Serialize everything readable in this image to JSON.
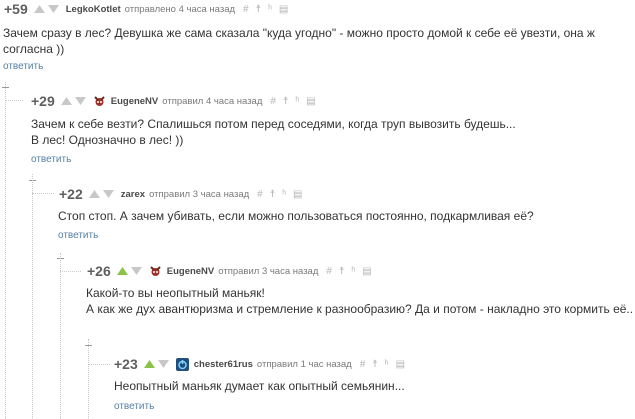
{
  "comments": [
    {
      "rating": "+59",
      "user": "LegkoKotlet",
      "meta": "отправлено 4 часа назад",
      "text": [
        "Зачем сразу в лес? Девушка же сама сказала \"куда угодно\" - можно просто домой к себе её увезти, она ж",
        "согласна ))"
      ],
      "reply": "ответить",
      "up_active": false
    },
    {
      "rating": "+29",
      "user": "EugeneNV",
      "meta": "отправил 4 часа назад",
      "text": [
        "Зачем к себе везти? Спалишься потом перед соседями, когда труп вывозить будешь...",
        "В лес! Однозначно в лес! ))"
      ],
      "reply": "ответить",
      "up_active": false
    },
    {
      "rating": "+22",
      "user": "zarex",
      "meta": "отправил 3 часа назад",
      "text": [
        "Стоп стоп. А зачем убивать, если можно пользоваться постоянно, подкармливая её?"
      ],
      "reply": "ответить",
      "up_active": false
    },
    {
      "rating": "+26",
      "user": "EugeneNV",
      "meta": "отправил 3 часа назад",
      "text": [
        "Какой-то вы неопытный маньяк!",
        "А как же дух авантюризма и стремление к разнообразию? Да и потом - накладно это кормить её..."
      ],
      "reply": "",
      "up_active": true
    },
    {
      "rating": "+23",
      "user": "chester61rus",
      "meta": "отправил 1 час назад",
      "text": [
        "Неопытный маньяк думает как опытный семьянин..."
      ],
      "reply": "ответить",
      "up_active": true
    }
  ],
  "icons": {
    "hash": "#",
    "person": "☨",
    "share": "ʰ",
    "save": "▤"
  },
  "colors": {
    "up_active": "#8bc34a",
    "arrow_inactive": "#c8c8c8",
    "link": "#5680a3"
  }
}
